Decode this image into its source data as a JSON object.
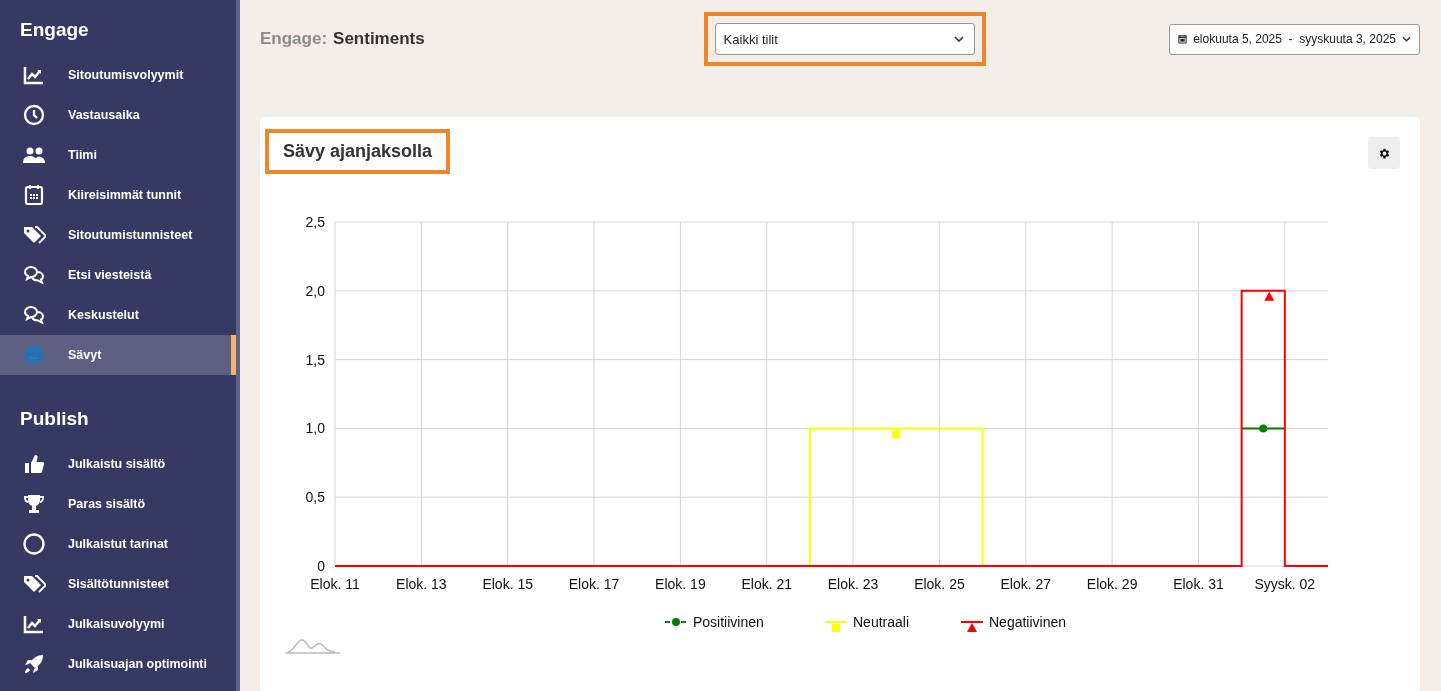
{
  "sidebar": {
    "sections": [
      {
        "title": "Engage",
        "items": [
          {
            "label": "Sitoutumisvolyymit",
            "selected": false
          },
          {
            "label": "Vastausaika",
            "selected": false
          },
          {
            "label": "Tiimi",
            "selected": false
          },
          {
            "label": "Kiireisimmät tunnit",
            "selected": false
          },
          {
            "label": "Sitoutumistunnisteet",
            "selected": false
          },
          {
            "label": "Etsi viesteistä",
            "selected": false
          },
          {
            "label": "Keskustelut",
            "selected": false
          },
          {
            "label": "Sävyt",
            "selected": true
          }
        ]
      },
      {
        "title": "Publish",
        "items": [
          {
            "label": "Julkaistu sisältö",
            "selected": false
          },
          {
            "label": "Paras sisältö",
            "selected": false
          },
          {
            "label": "Julkaistut tarinat",
            "selected": false
          },
          {
            "label": "Sisältötunnisteet",
            "selected": false
          },
          {
            "label": "Julkaisuvolyymi",
            "selected": false
          },
          {
            "label": "Julkaisuajan optimointi",
            "selected": false
          }
        ]
      }
    ]
  },
  "header": {
    "section": "Engage:",
    "page": "Sentiments",
    "account_select": {
      "value": "Kaikki tilit",
      "highlighted": true
    },
    "date_range": "elokuuta 5, 2025  -  syyskuuta 3, 2025"
  },
  "card": {
    "title": "Sävy ajanjaksolla",
    "title_highlighted": true,
    "chart_data": {
      "type": "line",
      "x": [
        "2025-08-11",
        "2025-08-22",
        "2025-08-22",
        "2025-08-26",
        "2025-08-26",
        "2025-09-01",
        "2025-09-01",
        "2025-09-02",
        "2025-09-02",
        "2025-09-03"
      ],
      "series": [
        {
          "name": "Positiivinen",
          "color": "#008000",
          "values": [
            null,
            null,
            null,
            null,
            null,
            null,
            1,
            1,
            null,
            null
          ]
        },
        {
          "name": "Neutraali",
          "color": "#ffff00",
          "values": [
            null,
            0,
            1,
            1,
            0,
            null,
            null,
            null,
            null,
            null
          ]
        },
        {
          "name": "Negatiivinen",
          "color": "#ff0000",
          "values": [
            0,
            0,
            0,
            0,
            0,
            0,
            2,
            2,
            0,
            0
          ]
        }
      ],
      "xlim": [
        "2025-08-11",
        "2025-09-03"
      ],
      "ylim": [
        0,
        2.5
      ],
      "grid": true,
      "legend": "bottom",
      "yticks": [
        {
          "value": 0,
          "label": "0"
        },
        {
          "value": 0.5,
          "label": "0,5"
        },
        {
          "value": 1,
          "label": "1,0"
        },
        {
          "value": 1.5,
          "label": "1,5"
        },
        {
          "value": 2,
          "label": "2,0"
        },
        {
          "value": 2.5,
          "label": "2,5"
        }
      ],
      "xticks": [
        {
          "value": "2025-08-11",
          "label": "Elok. 11"
        },
        {
          "value": "2025-08-13",
          "label": "Elok. 13"
        },
        {
          "value": "2025-08-15",
          "label": "Elok. 15"
        },
        {
          "value": "2025-08-17",
          "label": "Elok. 17"
        },
        {
          "value": "2025-08-19",
          "label": "Elok. 19"
        },
        {
          "value": "2025-08-21",
          "label": "Elok. 21"
        },
        {
          "value": "2025-08-23",
          "label": "Elok. 23"
        },
        {
          "value": "2025-08-25",
          "label": "Elok. 25"
        },
        {
          "value": "2025-08-27",
          "label": "Elok. 27"
        },
        {
          "value": "2025-08-29",
          "label": "Elok. 29"
        },
        {
          "value": "2025-08-31",
          "label": "Elok. 31"
        },
        {
          "value": "2025-09-02",
          "label": "Syysk. 02"
        }
      ]
    }
  }
}
